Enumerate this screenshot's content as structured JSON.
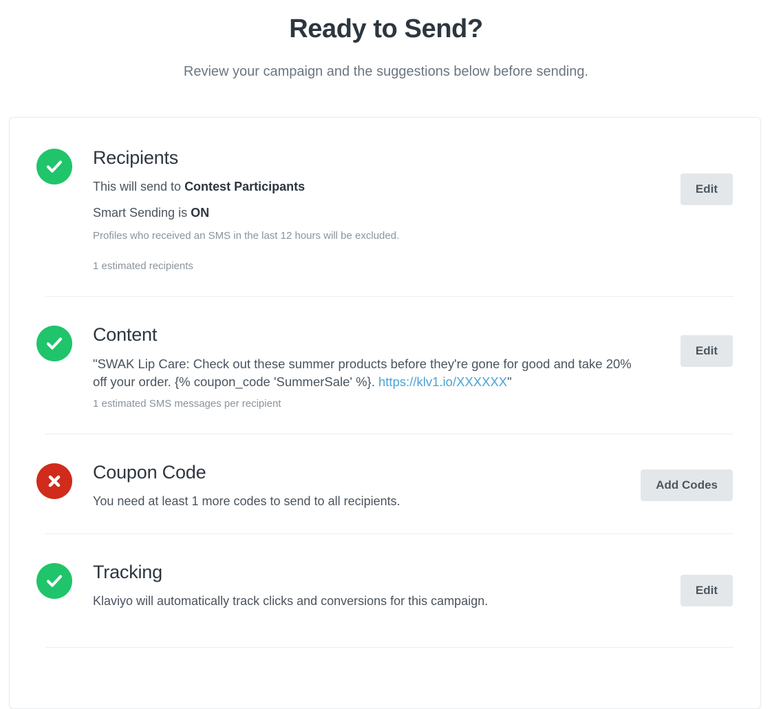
{
  "header": {
    "title": "Ready to Send?",
    "subtitle": "Review your campaign and the suggestions below before sending."
  },
  "colors": {
    "success": "#20c46a",
    "error": "#d02b1c",
    "link": "#4ba3d3",
    "button_bg": "#e3e7ea",
    "title_text": "#2d3640",
    "body_text": "#4a545e",
    "muted_text": "#8a939b"
  },
  "sections": [
    {
      "id": "recipients",
      "title": "Recipients",
      "status": "ok",
      "status_icon": "check-circle-icon",
      "lines": [
        {
          "prefix": "This will send to ",
          "strong": "Contest Participants",
          "suffix": ""
        },
        {
          "prefix": "Smart Sending is ",
          "strong": "ON",
          "suffix": ""
        }
      ],
      "note": "Profiles who received an SMS in the last 12 hours will be excluded.",
      "estimate": "1 estimated recipients",
      "action": {
        "label": "Edit",
        "name": "edit-recipients-button"
      }
    },
    {
      "id": "content",
      "title": "Content",
      "status": "ok",
      "status_icon": "check-circle-icon",
      "message_before_link": "\"SWAK Lip Care: Check out these summer products before they're gone for good and take 20% off your order. {% coupon_code 'SummerSale' %}. ",
      "message_link": "https://klv1.io/XXXXXX",
      "message_after_link": "\"",
      "estimate": "1 estimated SMS messages per recipient",
      "action": {
        "label": "Edit",
        "name": "edit-content-button"
      }
    },
    {
      "id": "coupon-code",
      "title": "Coupon Code",
      "status": "error",
      "status_icon": "x-circle-icon",
      "note": "You need at least 1 more codes to send to all recipients.",
      "action": {
        "label": "Add Codes",
        "name": "add-codes-button"
      }
    },
    {
      "id": "tracking",
      "title": "Tracking",
      "status": "ok",
      "status_icon": "check-circle-icon",
      "note": "Klaviyo will automatically track clicks and conversions for this campaign.",
      "action": {
        "label": "Edit",
        "name": "edit-tracking-button"
      }
    }
  ]
}
